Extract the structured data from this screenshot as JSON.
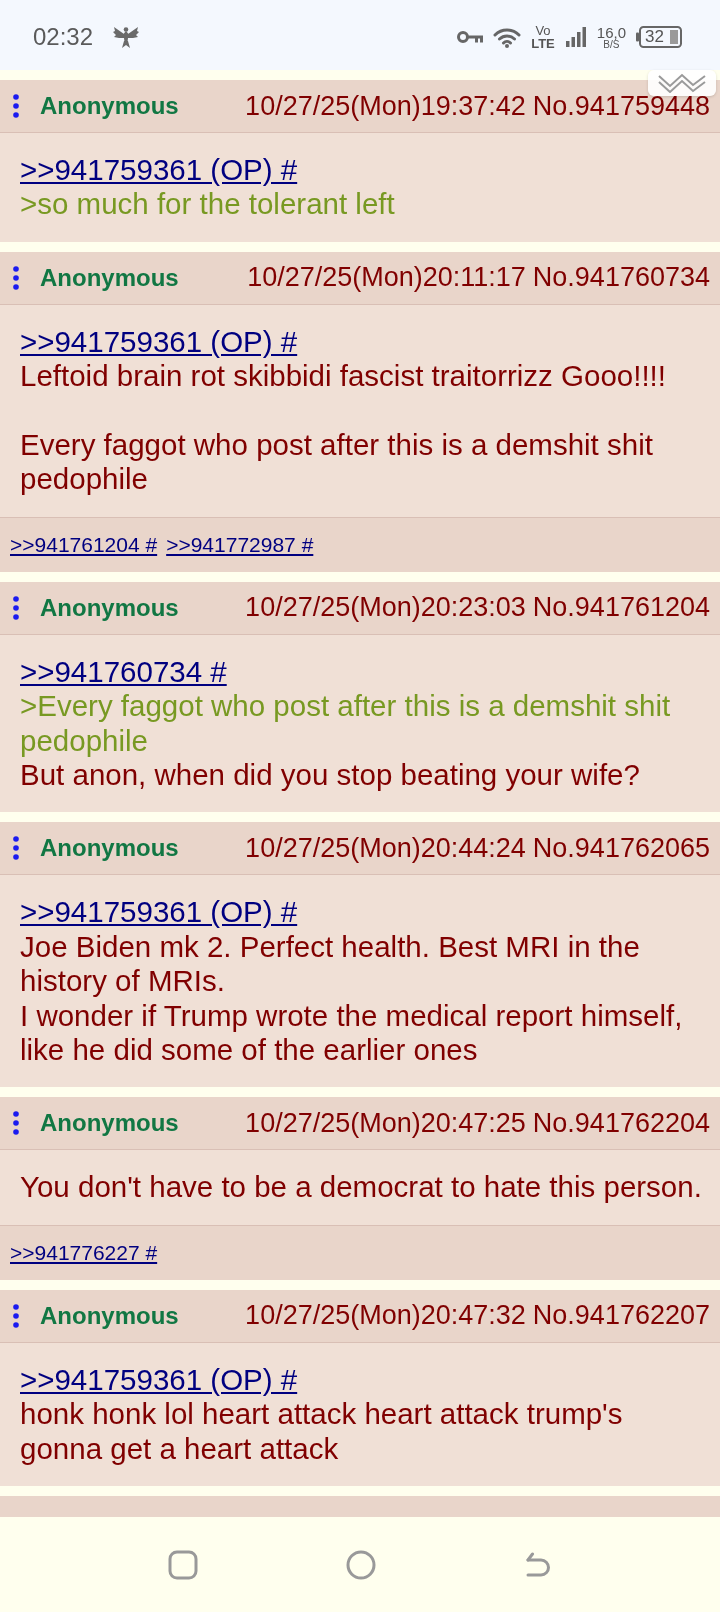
{
  "status_bar": {
    "time": "02:32",
    "volte_top": "Vo",
    "volte_bottom": "LTE",
    "speed": "16,0",
    "speed_unit": "B/S",
    "battery": "32"
  },
  "posts": [
    {
      "kind": "post",
      "name": "Anonymous",
      "datetime": "10/27/25(Mon)19:37:42",
      "number": "No.941759448",
      "body": [
        {
          "kind": "quotelink",
          "text": ">>941759361 (OP) #"
        },
        {
          "kind": "greentext",
          "text": ">so much for the tolerant left"
        }
      ]
    },
    {
      "kind": "post",
      "name": "Anonymous",
      "datetime": "10/27/25(Mon)20:11:17",
      "number": "No.941760734",
      "body": [
        {
          "kind": "quotelink",
          "text": ">>941759361 (OP) #"
        },
        {
          "kind": "text",
          "text": "Leftoid brain rot skibbidi fascist traitorrizz Gooo!!!!"
        },
        {
          "kind": "blank"
        },
        {
          "kind": "text",
          "text": "Every faggot who post after this is a demshit shit pedophile"
        }
      ],
      "replies": [
        ">>941761204 #",
        ">>941772987 #"
      ]
    },
    {
      "kind": "post",
      "name": "Anonymous",
      "datetime": "10/27/25(Mon)20:23:03",
      "number": "No.941761204",
      "body": [
        {
          "kind": "quotelink",
          "text": ">>941760734 #"
        },
        {
          "kind": "greentext",
          "text": ">Every faggot who post after this is a demshit shit pedophile"
        },
        {
          "kind": "text",
          "text": "But anon, when did you stop beating your wife?"
        }
      ]
    },
    {
      "kind": "post",
      "name": "Anonymous",
      "datetime": "10/27/25(Mon)20:44:24",
      "number": "No.941762065",
      "body": [
        {
          "kind": "quotelink",
          "text": ">>941759361 (OP) #"
        },
        {
          "kind": "text",
          "text": "Joe Biden mk 2. Perfect health. Best MRI in the history of MRIs."
        },
        {
          "kind": "text",
          "text": "I wonder if Trump wrote the medical report himself, like he did some of the earlier ones"
        }
      ]
    },
    {
      "kind": "post",
      "name": "Anonymous",
      "datetime": "10/27/25(Mon)20:47:25",
      "number": "No.941762204",
      "body": [
        {
          "kind": "text",
          "text": "You don't have to be a democrat to hate this person."
        }
      ],
      "replies": [
        ">>941776227 #"
      ]
    },
    {
      "kind": "post",
      "name": "Anonymous",
      "datetime": "10/27/25(Mon)20:47:32",
      "number": "No.941762207",
      "body": [
        {
          "kind": "quotelink",
          "text": ">>941759361 (OP) #"
        },
        {
          "kind": "text",
          "text": "honk honk lol heart attack heart attack trump's gonna get a heart attack"
        }
      ]
    },
    {
      "kind": "partial"
    }
  ]
}
